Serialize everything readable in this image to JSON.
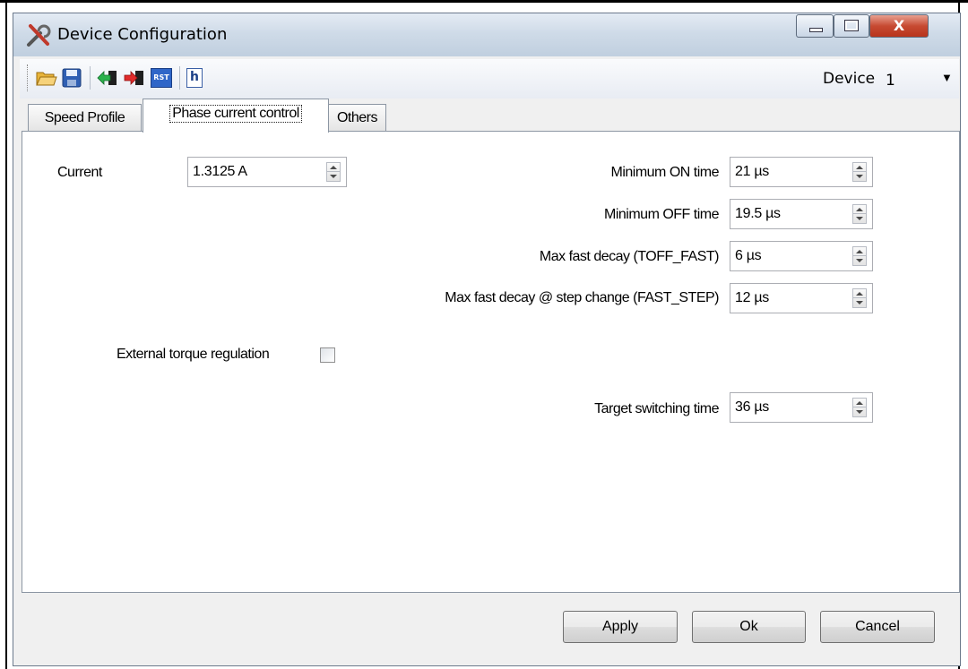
{
  "window": {
    "title": "Device Configuration"
  },
  "toolbar": {
    "device_label": "Device",
    "device_value": "1",
    "icons": [
      "open-folder-icon",
      "save-icon",
      "import-icon",
      "export-icon",
      "reset-icon",
      "header-file-icon"
    ],
    "reset_text": "RST",
    "header_text": "h"
  },
  "tabs": [
    {
      "label": "Speed Profile",
      "active": false
    },
    {
      "label": "Phase current control",
      "active": true
    },
    {
      "label": "Others",
      "active": false
    }
  ],
  "form": {
    "current": {
      "label": "Current",
      "value": "1.3125 A"
    },
    "min_on_time": {
      "label": "Minimum ON time",
      "value": "21 µs"
    },
    "min_off_time": {
      "label": "Minimum OFF time",
      "value": "19.5 µs"
    },
    "max_fast_decay": {
      "label": "Max fast decay (TOFF_FAST)",
      "value": "6 µs"
    },
    "max_fast_decay_step": {
      "label": "Max fast decay @ step change (FAST_STEP)",
      "value": "12 µs"
    },
    "external_torque": {
      "label": "External torque regulation",
      "checked": false
    },
    "target_switching": {
      "label": "Target switching time",
      "value": "36 µs"
    }
  },
  "buttons": {
    "apply": "Apply",
    "ok": "Ok",
    "cancel": "Cancel"
  },
  "caption_buttons": {
    "close_glyph": "X"
  },
  "colors": {
    "titlebar": "#cfdbe8",
    "close": "#c74a32",
    "panel": "#ffffff",
    "window": "#f0f0f0"
  }
}
